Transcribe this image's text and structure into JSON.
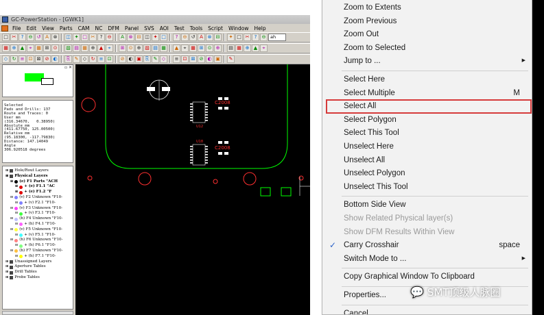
{
  "window": {
    "title": "GC-PowerStation - [GWK1]"
  },
  "menubar": [
    "File",
    "Edit",
    "View",
    "Parts",
    "CAM",
    "NC",
    "DFM",
    "Panel",
    "SVS",
    "AOI",
    "Test",
    "Tools",
    "Script",
    "Window",
    "Help"
  ],
  "toolbar": {
    "layer_select": "ah"
  },
  "info_panel": {
    "text": "Selected\nPads and Drills: 137\nRoute and Traces: 0\nUser mm\n(316.34670,   0.38950)\nAbsolute mm\n(411.67750, 125.00500)\nRelative mm\n(95.18300, -117.79830)\nDistance: 147.14049\nAngle\n306.920518 degrees"
  },
  "layers": [
    {
      "text": "Hole/Rout Layers",
      "indent": 1
    },
    {
      "text": "Physical Layers",
      "indent": 1,
      "bold": true
    },
    {
      "text": "(e) F1 Parts \"ACH",
      "indent": 2,
      "bold": true,
      "color": "#000000"
    },
    {
      "text": "+ (e) F1.1 \"AC",
      "indent": 3,
      "bold": true,
      "color": "#e00000"
    },
    {
      "text": "+ (e) F1.2 \"F",
      "indent": 3,
      "bold": true,
      "color": "#e00000"
    },
    {
      "text": "(v) F2 Unknown \"F10-",
      "indent": 2,
      "color": "#8080ff"
    },
    {
      "text": "+ (v) F2.1 \"F10-",
      "indent": 3,
      "color": "#8080ff"
    },
    {
      "text": "(v) F3 Unknown \"F10-",
      "indent": 2,
      "color": "#ff40ff"
    },
    {
      "text": "+ (v) F3.1 \"F10-",
      "indent": 3,
      "color": "#40ff40"
    },
    {
      "text": "(h) F4 Unknown \"F10-",
      "indent": 2,
      "color": "#c0c0ff"
    },
    {
      "text": "+ (h) F4.1 \"F10-",
      "indent": 3,
      "color": "#ff60ff"
    },
    {
      "text": "(v) F5 Unknown \"F10-",
      "indent": 2,
      "color": "#ffff40"
    },
    {
      "text": "+ (v) F5.1 \"F10-",
      "indent": 3,
      "color": "#40ffff"
    },
    {
      "text": "(h) F6 Unknown \"F10-",
      "indent": 2,
      "color": "#ff8080"
    },
    {
      "text": "+ (h) F6.1 \"F10-",
      "indent": 3,
      "color": "#80ff80"
    },
    {
      "text": "(h) F7 Unknown \"F10-",
      "indent": 2,
      "color": "#ffc040"
    },
    {
      "text": "+ (h) F7.1 \"F10-",
      "indent": 3,
      "color": "#ffff00"
    },
    {
      "text": "Unassigned Layers",
      "indent": 1
    },
    {
      "text": "Aperture Tables",
      "indent": 1
    },
    {
      "text": "Drill Tables",
      "indent": 1
    },
    {
      "text": "Probe Tables",
      "indent": 1
    }
  ],
  "canvas": {
    "part_labels": [
      "C2008",
      "C2008",
      "U12",
      "U18"
    ],
    "colors": {
      "background": "#000000",
      "outline": "#00ff00",
      "pads": "#ff3030",
      "silk": "#ffffff"
    }
  },
  "context_menu": {
    "items": [
      {
        "label": "Zoom to Extents"
      },
      {
        "label": "Zoom Previous"
      },
      {
        "label": "Zoom Out"
      },
      {
        "label": "Zoom to Selected"
      },
      {
        "label": "Jump to ...",
        "submenu": true
      },
      {
        "sep": true
      },
      {
        "label": "Select Here"
      },
      {
        "label": "Select Multiple",
        "shortcut": "M"
      },
      {
        "label": "Select All",
        "highlighted": true
      },
      {
        "label": "Select Polygon"
      },
      {
        "label": "Select This Tool"
      },
      {
        "label": "Unselect Here"
      },
      {
        "label": "Unselect All"
      },
      {
        "label": "Unselect Polygon"
      },
      {
        "label": "Unselect This Tool"
      },
      {
        "sep": true
      },
      {
        "label": "Bottom Side View"
      },
      {
        "label": "Show Related Physical layer(s)",
        "disabled": true
      },
      {
        "label": "Show DFM Results Within View",
        "disabled": true
      },
      {
        "label": "Carry Crosshair",
        "shortcut": "space",
        "checked": true
      },
      {
        "label": "Switch Mode to ...",
        "submenu": true
      },
      {
        "sep": true
      },
      {
        "label": "Copy Graphical Window To Clipboard"
      },
      {
        "sep": true
      },
      {
        "label": "Properties..."
      },
      {
        "sep": true
      },
      {
        "label": "Cancel"
      }
    ],
    "highlight_color": "#d63a3a"
  },
  "watermark": {
    "text": "SMT顶级人脉圈"
  }
}
